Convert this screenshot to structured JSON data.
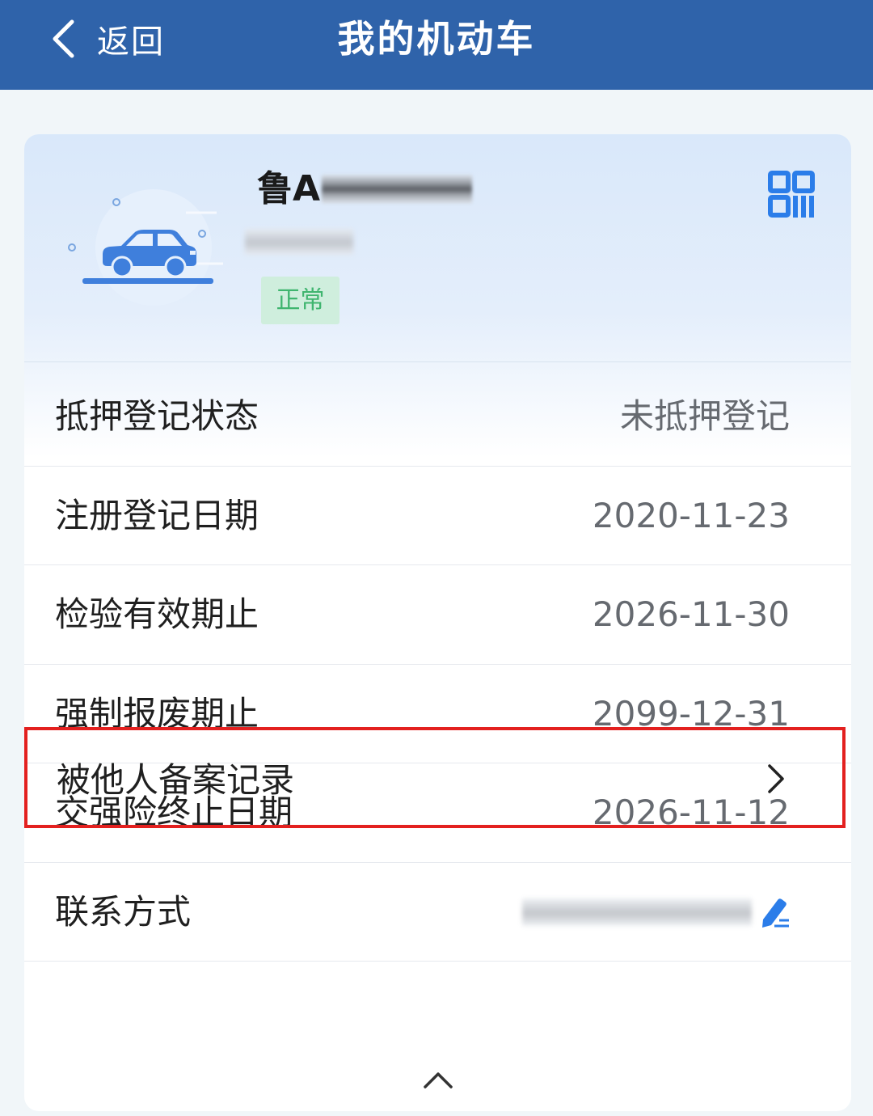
{
  "header": {
    "back_label": "返回",
    "title": "我的机动车"
  },
  "vehicle": {
    "plate_prefix": "鲁A",
    "status": "正常"
  },
  "rows": [
    {
      "label": "抵押登记状态",
      "value": "未抵押登记"
    },
    {
      "label": "注册登记日期",
      "value": "2020-11-23"
    },
    {
      "label": "检验有效期止",
      "value": "2026-11-30"
    },
    {
      "label": "强制报废期止",
      "value": "2099-12-31"
    },
    {
      "label": "交强险终止日期",
      "value": "2026-11-12"
    },
    {
      "label": "联系方式",
      "value": ""
    }
  ],
  "filing_record": {
    "label": "被他人备案记录"
  },
  "colors": {
    "header_bg": "#2f63aa",
    "accent_blue": "#2b7de9",
    "status_green": "#3fb56f",
    "status_bg": "#cfeedd",
    "highlight_red": "#e3201f"
  },
  "icons": [
    "chevron-left-icon",
    "car-icon",
    "qr-code-icon",
    "edit-icon",
    "chevron-right-icon",
    "chevron-up-icon"
  ]
}
